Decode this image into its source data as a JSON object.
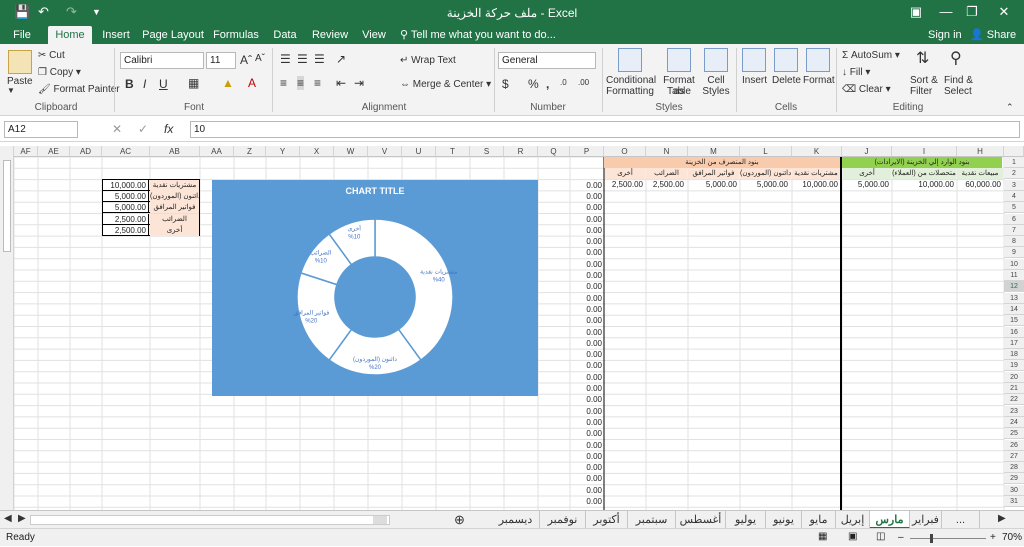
{
  "title_bar": {
    "title": "ملف حركة الخزينة - Excel",
    "user": "Sign in",
    "share": "Share"
  },
  "tabs": [
    "File",
    "Home",
    "Insert",
    "Page Layout",
    "Formulas",
    "Data",
    "Review",
    "View"
  ],
  "tell_me": "Tell me what you want to do...",
  "ribbon": {
    "clipboard": {
      "paste": "Paste",
      "cut": "Cut",
      "copy": "Copy",
      "painter": "Format Painter",
      "label": "Clipboard"
    },
    "font": {
      "name": "Calibri",
      "size": "11",
      "label": "Font"
    },
    "alignment": {
      "wrap": "Wrap Text",
      "merge": "Merge & Center",
      "label": "Alignment"
    },
    "number": {
      "format": "General",
      "label": "Number"
    },
    "styles": {
      "cond1": "Conditional",
      "cond2": "Formatting",
      "table1": "Format as",
      "table2": "Table",
      "cell1": "Cell",
      "cell2": "Styles",
      "label": "Styles"
    },
    "cells": {
      "insert": "Insert",
      "delete": "Delete",
      "format": "Format",
      "label": "Cells"
    },
    "editing": {
      "autosum": "AutoSum",
      "fill": "Fill",
      "clear": "Clear",
      "sort1": "Sort &",
      "sort2": "Filter",
      "find1": "Find &",
      "find2": "Select",
      "label": "Editing"
    }
  },
  "formula_bar": {
    "name_box": "A12",
    "fx": "fx",
    "value": "10"
  },
  "columns": [
    "AF",
    "AE",
    "AD",
    "AC",
    "AB",
    "AA",
    "Z",
    "Y",
    "X",
    "W",
    "V",
    "U",
    "T",
    "S",
    "R",
    "Q",
    "P",
    "O",
    "N",
    "M",
    "L",
    "K",
    "J",
    "I",
    "H"
  ],
  "rows": [
    "1",
    "2",
    "3",
    "4",
    "5",
    "6",
    "7",
    "8",
    "9",
    "10",
    "11",
    "12",
    "13",
    "14",
    "15",
    "16",
    "17",
    "18",
    "19",
    "20",
    "21",
    "22",
    "23",
    "24",
    "25",
    "26",
    "27",
    "28",
    "29",
    "30",
    "31"
  ],
  "selected_row": "12",
  "headers": {
    "incoming_title": "بنود الوارد إلي الخزينة (الايرادات)",
    "outgoing_title": "بنود المنصرف من الخزينة",
    "incoming_cols": [
      "مبيعات نقدية",
      "متحصلات من (العملاء)",
      "أخرى"
    ],
    "outgoing_cols": [
      "مشتريات نقدية",
      "دائنون (الموردون)",
      "فواتير المرافق",
      "الضرائب",
      "أخرى"
    ]
  },
  "row3": {
    "H": "60,000.00",
    "I": "10,000.00",
    "J": "5,000.00",
    "K": "10,000.00",
    "L": "5,000.00",
    "M": "5,000.00",
    "N": "2,500.00",
    "O": "2,500.00"
  },
  "p_column_value": "0.00",
  "summary_table": [
    {
      "label": "مشتريات نقدية",
      "value": "10,000.00"
    },
    {
      "label": "دائنون (الموردون)",
      "value": "5,000.00"
    },
    {
      "label": "فواتير المرافق",
      "value": "5,000.00"
    },
    {
      "label": "الضرائب",
      "value": "2,500.00"
    },
    {
      "label": "أخرى",
      "value": "2,500.00"
    }
  ],
  "chart_data": {
    "type": "pie",
    "title": "CHART TITLE",
    "categories": [
      "مشتريات نقدية",
      "دائنون (الموردون)",
      "فواتير المرافق",
      "الضرائب",
      "أخرى"
    ],
    "values": [
      40,
      20,
      20,
      10,
      10
    ],
    "labels": [
      "%40",
      "%20",
      "%20",
      "%10",
      "%10"
    ],
    "donut": true,
    "background": "#5b9bd5",
    "slice_color": "#ffffff"
  },
  "sheet_tabs": [
    "...",
    "فبراير",
    "مارس",
    "إبريل",
    "مايو",
    "يونيو",
    "يوليو",
    "أغسطس",
    "سبتمبر",
    "أكتوبر",
    "نوفمبر",
    "ديسمبر"
  ],
  "active_sheet": "مارس",
  "status": {
    "ready": "Ready",
    "zoom": "70%"
  },
  "colors": {
    "excel_green": "#217346",
    "incoming_header": "#92d050",
    "outgoing_header": "#f8cbad",
    "incoming_sub": "#e2efda",
    "outgoing_sub": "#fce4d6"
  }
}
